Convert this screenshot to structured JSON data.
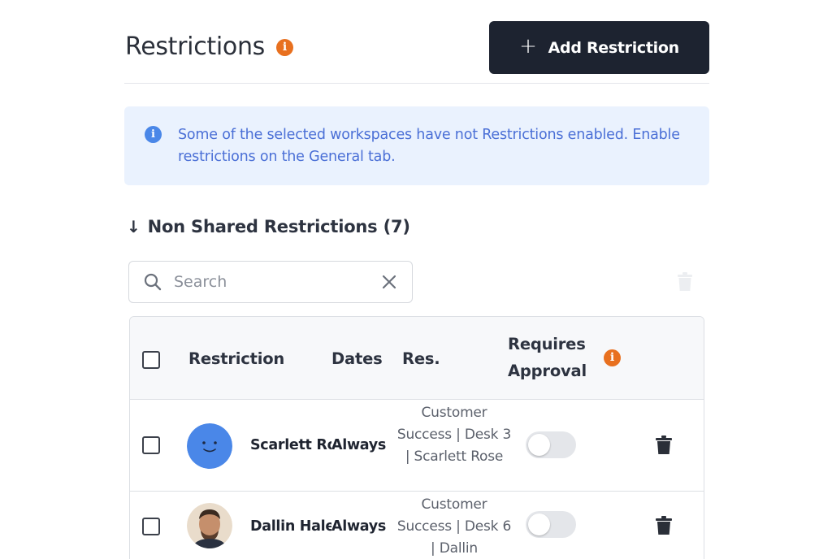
{
  "header": {
    "title": "Restrictions",
    "info_icon": "info-icon",
    "add_button_label": "Add Restriction"
  },
  "banner": {
    "icon": "info-icon",
    "text": "Some of the selected workspaces have not Restrictions enabled. Enable restrictions on the General tab."
  },
  "section": {
    "arrow": "↓",
    "title": "Non Shared Restrictions (7)"
  },
  "search": {
    "placeholder": "Search",
    "value": ""
  },
  "table": {
    "columns": {
      "restriction": "Restriction",
      "dates": "Dates",
      "res": "Res.",
      "requires_approval_1": "Requires",
      "requires_approval_2": "Approval"
    },
    "rows": [
      {
        "name": "Scarlett Rose",
        "dates": "Always",
        "res": "Customer Success | Desk 3 | Scarlett Rose",
        "requires_approval": false,
        "avatar": "smiley-avatar"
      },
      {
        "name": "Dallin Hale",
        "dates": "Always",
        "res": "Customer Success | Desk 6 | Dallin",
        "requires_approval": false,
        "avatar": "photo-avatar"
      }
    ]
  },
  "colors": {
    "primary_button": "#1d2330",
    "info_orange": "#e8701f",
    "banner_bg": "#eaf2fe",
    "banner_text": "#4a6fd6",
    "avatar_blue": "#4a87e8"
  }
}
